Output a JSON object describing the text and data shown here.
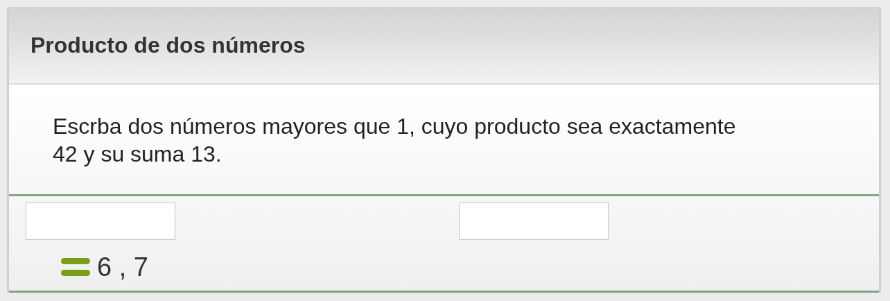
{
  "title": "Producto de dos números",
  "question": "Escrba dos números mayores que 1, cuyo producto sea exactamente 42 y su suma 13.",
  "answer": "6 , 7"
}
